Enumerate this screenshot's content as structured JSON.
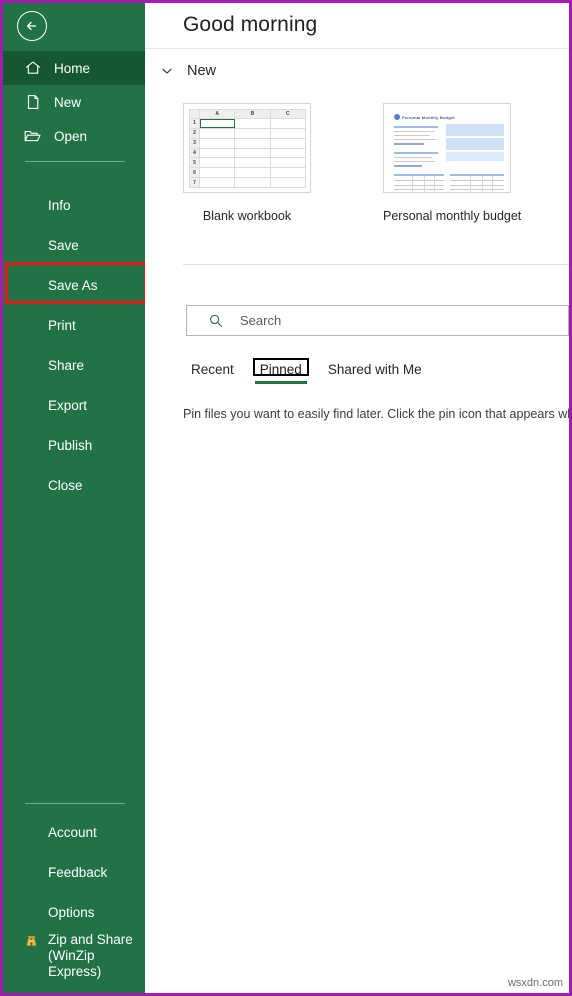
{
  "window": {
    "accent_border_color": "#a21caf",
    "sidebar_color": "#217346",
    "sidebar_selected_color": "#15572f",
    "highlight_color": "#e01b18"
  },
  "sidebar": {
    "back_button": "back-arrow-icon",
    "top_items": [
      {
        "label": "Home",
        "icon": "home-icon",
        "selected": true
      },
      {
        "label": "New",
        "icon": "new-document-icon",
        "selected": false
      },
      {
        "label": "Open",
        "icon": "open-folder-icon",
        "selected": false
      }
    ],
    "mid_items": [
      {
        "label": "Info",
        "highlighted": false
      },
      {
        "label": "Save",
        "highlighted": false
      },
      {
        "label": "Save As",
        "highlighted": true
      },
      {
        "label": "Print",
        "highlighted": false
      },
      {
        "label": "Share",
        "highlighted": false
      },
      {
        "label": "Export",
        "highlighted": false
      },
      {
        "label": "Publish",
        "highlighted": false
      },
      {
        "label": "Close",
        "highlighted": false
      }
    ],
    "bottom_items": [
      {
        "label": "Account"
      },
      {
        "label": "Feedback"
      },
      {
        "label": "Options"
      }
    ],
    "zip_item": {
      "label": "Zip and Share (WinZip Express)",
      "icon": "winzip-icon"
    }
  },
  "header": {
    "greeting": "Good morning"
  },
  "new_section": {
    "label": "New",
    "chevron": "chevron-down-icon",
    "templates": [
      {
        "caption": "Blank workbook",
        "thumb_type": "spreadsheet-grid",
        "columns": [
          "A",
          "B",
          "C"
        ],
        "rows": [
          "1",
          "2",
          "3",
          "4",
          "5",
          "6",
          "7"
        ],
        "selected_cell": "A1"
      },
      {
        "caption": "Personal monthly budget",
        "thumb_type": "budget-template",
        "thumb_title": "Personal Monthly Budget"
      }
    ]
  },
  "search": {
    "icon": "search-icon",
    "placeholder": "Search",
    "value": ""
  },
  "file_tabs": [
    {
      "label": "Recent",
      "active": false
    },
    {
      "label": "Pinned",
      "active": true
    },
    {
      "label": "Shared with Me",
      "active": false
    }
  ],
  "pinned_message": "Pin files you want to easily find later. Click the pin icon that appears when",
  "watermark": "wsxdn.com"
}
